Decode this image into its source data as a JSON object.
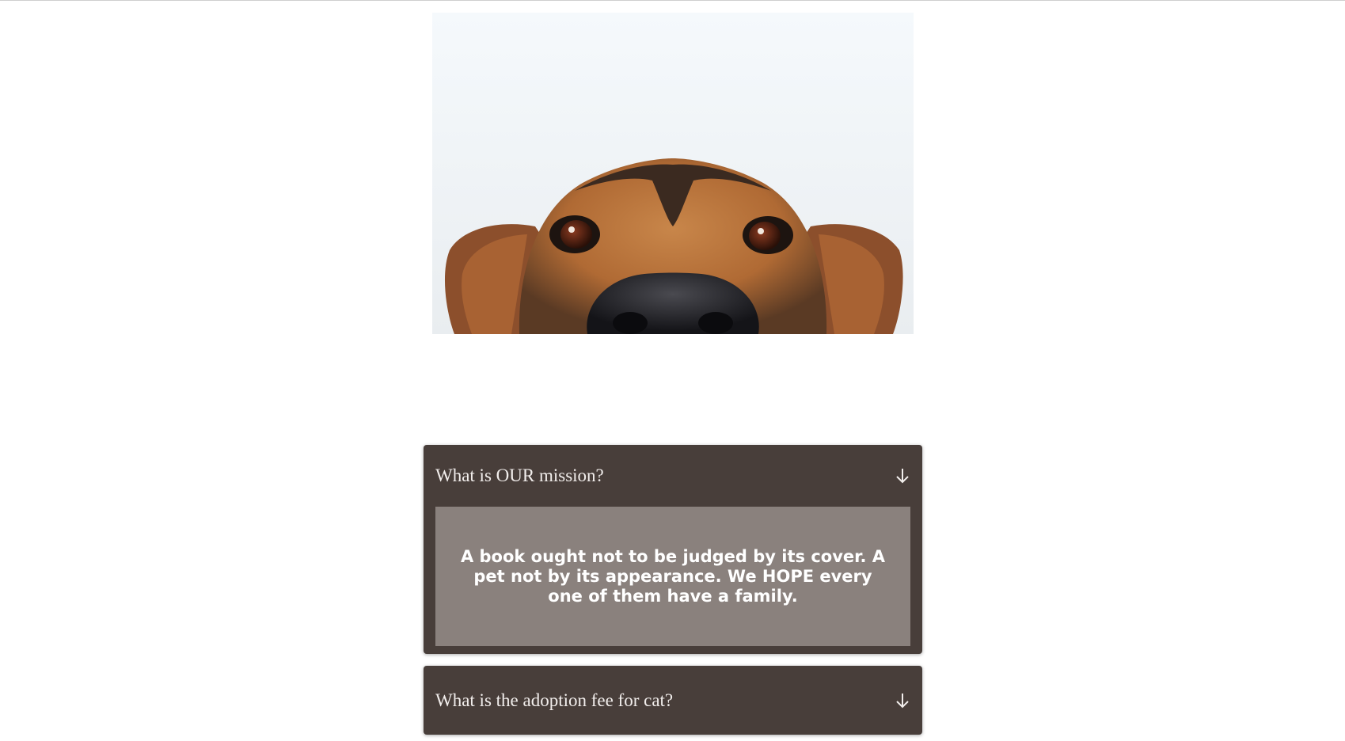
{
  "hero": {
    "image_alt": "Dog peeking up from below the frame"
  },
  "faq": [
    {
      "question": "What is OUR mission?",
      "expanded": true,
      "answer": "A book ought not to be judged by its cover. A pet not by its appearance. We HOPE every one of them have a family."
    },
    {
      "question": "What is the adoption fee for cat?",
      "expanded": false
    }
  ],
  "colors": {
    "panel": "#483e3a",
    "answer_bg": "#8a817d",
    "text": "#f2eeec"
  },
  "icons": {
    "toggle": "arrow-down-icon"
  }
}
